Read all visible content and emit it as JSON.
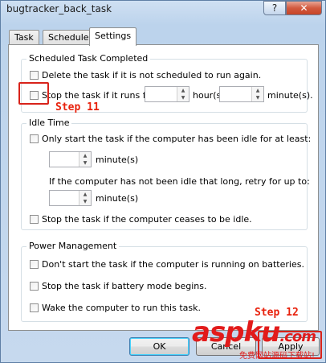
{
  "window": {
    "title": "bugtracker_back_task",
    "help_label": "?",
    "close_label": "✕"
  },
  "tabs": [
    {
      "label": "Task",
      "active": false
    },
    {
      "label": "Schedule",
      "active": false
    },
    {
      "label": "Settings",
      "active": true
    }
  ],
  "scheduled_group": {
    "title": "Scheduled Task Completed",
    "delete_label": "Delete the task if it is not scheduled to run again.",
    "stop_label": "Stop the task if it runs for:",
    "hours_value": "",
    "hours_label": "hour(s)",
    "minutes_value": "",
    "minutes_label": "minute(s)."
  },
  "idle_group": {
    "title": "Idle Time",
    "only_start_label": "Only start the task if the computer has been idle for at least:",
    "idle_minutes_value": "",
    "idle_minutes_label": "minute(s)",
    "retry_label": "If the computer has not been idle that long, retry for up to:",
    "retry_minutes_value": "",
    "retry_minutes_label": "minute(s)",
    "stop_idle_label": "Stop the task if the computer ceases to be idle."
  },
  "power_group": {
    "title": "Power Management",
    "batteries_label": "Don't start the task if the computer is running on batteries.",
    "battery_mode_label": "Stop the task if battery mode begins.",
    "wake_label": "Wake the computer to run this task."
  },
  "buttons": {
    "ok_label": "OK",
    "cancel_label": "Cancel",
    "apply_label": "Apply"
  },
  "annotations": {
    "step11": "Step 11",
    "step12": "Step 12",
    "color": "#e8210c"
  },
  "watermark": {
    "brand": "aspku",
    "domain": ".com",
    "subtitle": "免费网站源码下载站!"
  },
  "icons": {
    "spin_up": "triangle-up-icon",
    "spin_down": "triangle-down-icon"
  }
}
